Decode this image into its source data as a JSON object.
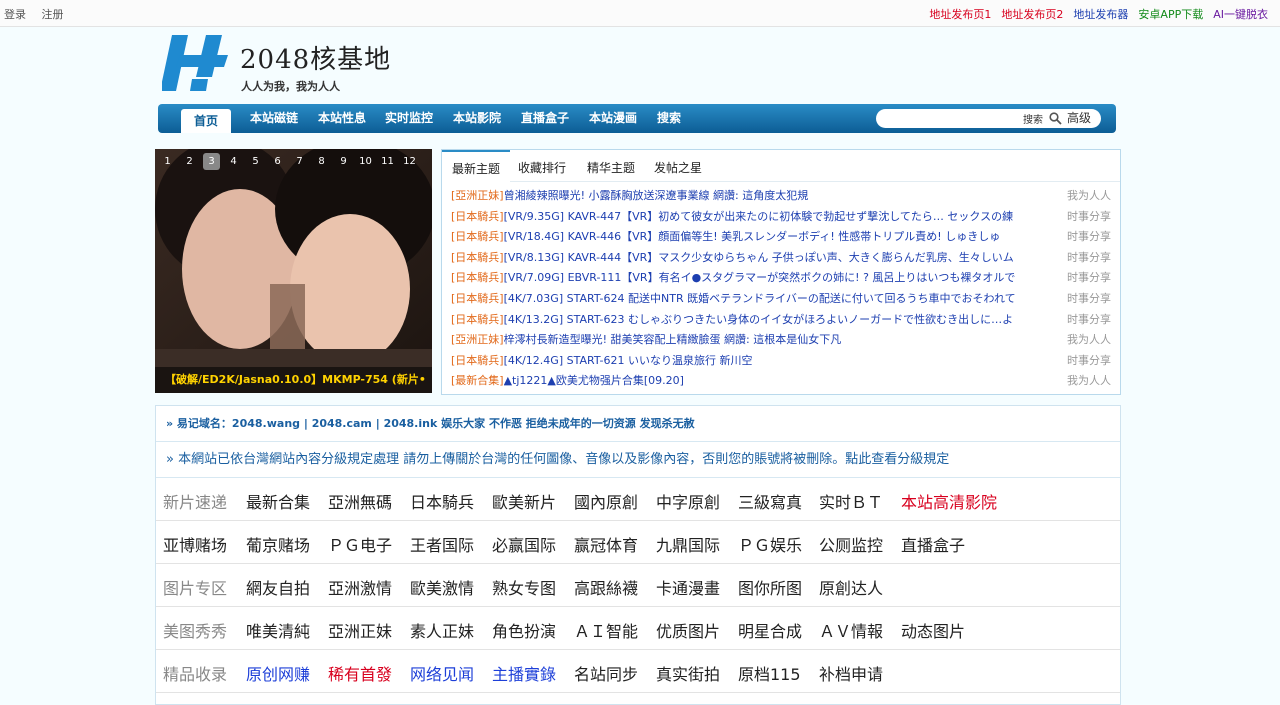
{
  "topbar": {
    "left": [
      "登录",
      "注册"
    ],
    "right": [
      {
        "label": "地址发布页1",
        "color": "#d8001e"
      },
      {
        "label": "地址发布页2",
        "color": "#d8001e"
      },
      {
        "label": "地址发布器",
        "color": "#1d3fb0"
      },
      {
        "label": "安卓APP下载",
        "color": "#118a18"
      },
      {
        "label": "AI一键脱衣",
        "color": "#6a1aa0"
      }
    ]
  },
  "logo": {
    "title": "2048核基地",
    "slogan": "人人为我，我为人人"
  },
  "nav": {
    "items": [
      "首页",
      "本站磁链",
      "本站性息",
      "实时监控",
      "本站影院",
      "直播盒子",
      "本站漫画",
      "搜索"
    ],
    "search": {
      "placeholder": "",
      "button": "搜索",
      "advanced": "高级"
    }
  },
  "slideshow": {
    "pages": [
      "1",
      "2",
      "3",
      "4",
      "5",
      "6",
      "7",
      "8",
      "9",
      "10",
      "11",
      "12"
    ],
    "active": "3",
    "caption": "【破解/ED2K/Jasna0.10.0】MKMP-754 (新片•"
  },
  "threads": {
    "tabs": [
      "最新主题",
      "收藏排行",
      "精华主题",
      "发帖之星"
    ],
    "rows": [
      {
        "cat": "[亞洲正妹]",
        "title": "曾湘綾辣照曝光! 小露酥胸放送深遼事業線 網讚: 這角度太犯規",
        "author": "我为人人"
      },
      {
        "cat": "[日本騎兵]",
        "title": "[VR/9.35G] KAVR-447【VR】初めて彼女が出来たのに初体験で勃起せず撃沈してたら… セックスの練",
        "author": "时事分享"
      },
      {
        "cat": "[日本騎兵]",
        "title": "[VR/18.4G] KAVR-446【VR】顔面偏等生! 美乳スレンダーボディ! 性感帯トリプル責め! しゅきしゅ",
        "author": "时事分享"
      },
      {
        "cat": "[日本騎兵]",
        "title": "[VR/8.13G] KAVR-444【VR】マスク少女ゆらちゃん 子供っぽい声、大きく膨らんだ乳房、生々しいム",
        "author": "时事分享"
      },
      {
        "cat": "[日本騎兵]",
        "title": "[VR/7.09G] EBVR-111【VR】有名イ●スタグラマーが突然ボクの姉に! ? 風呂上りはいつも裸タオルで",
        "author": "时事分享"
      },
      {
        "cat": "[日本騎兵]",
        "title": "[4K/7.03G] START-624 配送中NTR 既婚ベテランドライバーの配送に付いて回るうち車中でおそわれて",
        "author": "时事分享"
      },
      {
        "cat": "[日本騎兵]",
        "title": "[4K/13.2G] START-623 むしゃぶりつきたい身体のイイ女がほろよいノーガードで性欲むき出しに…よ",
        "author": "时事分享"
      },
      {
        "cat": "[亞洲正妹]",
        "title": "梓澪村長新造型曝光! 甜美笑容配上精緻臉蛋 網讚: 這根本是仙女下凡",
        "author": "我为人人"
      },
      {
        "cat": "[日本騎兵]",
        "title": "[4K/12.4G] START-621 いいなり温泉旅行 新川空",
        "author": "时事分享"
      },
      {
        "cat": "[最新合集]",
        "title": "▲tj1221▲欧美尤物强片合集[09.20]",
        "author": "我为人人"
      }
    ]
  },
  "notices": [
    "» 易记域名：2048.wang | 2048.cam | 2048.ink 娱乐大家 不作恶 拒绝未成年的一切资源 发现杀无赦",
    "» 本網站已依台灣網站內容分級規定處理 請勿上傳關於台灣的任何圖像、音像以及影像內容，否則您的賬號將被刪除。點此查看分級規定"
  ],
  "categories": [
    {
      "label": "新片速递",
      "label_color": "#888888",
      "links": [
        {
          "t": "最新合集",
          "c": "#222222"
        },
        {
          "t": "亞洲無碼",
          "c": "#222222"
        },
        {
          "t": "日本騎兵",
          "c": "#222222"
        },
        {
          "t": "歐美新片",
          "c": "#222222"
        },
        {
          "t": "國內原創",
          "c": "#222222"
        },
        {
          "t": "中字原創",
          "c": "#222222"
        },
        {
          "t": "三級寫真",
          "c": "#222222"
        },
        {
          "t": "实时ＢＴ",
          "c": "#222222"
        },
        {
          "t": "本站高清影院",
          "c": "#d8001e"
        }
      ]
    },
    {
      "label": "亚博赌场",
      "label_color": "#222222",
      "links": [
        {
          "t": "葡京赌场",
          "c": "#222222"
        },
        {
          "t": "ＰＧ电子",
          "c": "#222222"
        },
        {
          "t": "王者国际",
          "c": "#222222"
        },
        {
          "t": "必赢国际",
          "c": "#222222"
        },
        {
          "t": "赢冠体育",
          "c": "#222222"
        },
        {
          "t": "九鼎国际",
          "c": "#222222"
        },
        {
          "t": "ＰＧ娱乐",
          "c": "#222222"
        },
        {
          "t": "公厕监控",
          "c": "#222222"
        },
        {
          "t": "直播盒子",
          "c": "#222222"
        }
      ]
    },
    {
      "label": "图片专区",
      "label_color": "#888888",
      "links": [
        {
          "t": "網友自拍",
          "c": "#222222"
        },
        {
          "t": "亞洲激情",
          "c": "#222222"
        },
        {
          "t": "歐美激情",
          "c": "#222222"
        },
        {
          "t": "熟女专图",
          "c": "#222222"
        },
        {
          "t": "高跟絲襪",
          "c": "#222222"
        },
        {
          "t": "卡通漫畫",
          "c": "#222222"
        },
        {
          "t": "图你所图",
          "c": "#222222"
        },
        {
          "t": "原創达人",
          "c": "#222222"
        }
      ]
    },
    {
      "label": "美图秀秀",
      "label_color": "#888888",
      "links": [
        {
          "t": "唯美清純",
          "c": "#222222"
        },
        {
          "t": "亞洲正妹",
          "c": "#222222"
        },
        {
          "t": "素人正妹",
          "c": "#222222"
        },
        {
          "t": "角色扮演",
          "c": "#222222"
        },
        {
          "t": "ＡＩ智能",
          "c": "#222222"
        },
        {
          "t": "优质图片",
          "c": "#222222"
        },
        {
          "t": "明星合成",
          "c": "#222222"
        },
        {
          "t": "ＡＶ情報",
          "c": "#222222"
        },
        {
          "t": "动态图片",
          "c": "#222222"
        }
      ]
    },
    {
      "label": "精品收录",
      "label_color": "#888888",
      "links": [
        {
          "t": "原创网赚",
          "c": "#1d3fd8"
        },
        {
          "t": "稀有首發",
          "c": "#d8001e"
        },
        {
          "t": "网络见闻",
          "c": "#1d3fd8"
        },
        {
          "t": "主播實錄",
          "c": "#1d3fd8"
        },
        {
          "t": "名站同步",
          "c": "#222222"
        },
        {
          "t": "真实街拍",
          "c": "#222222"
        },
        {
          "t": "原档115",
          "c": "#222222"
        },
        {
          "t": "补档申请",
          "c": "#222222"
        }
      ]
    }
  ]
}
